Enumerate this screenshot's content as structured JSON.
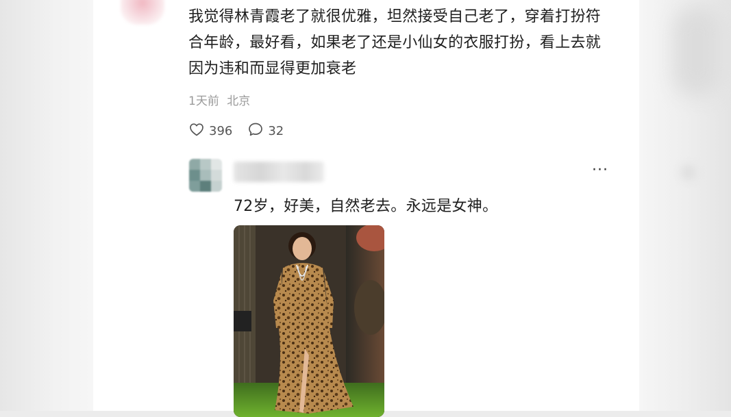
{
  "comment": {
    "text": "我觉得林青霞老了就很优雅，坦然接受自己老了，穿着打扮符合年龄，最好看，如果老了还是小仙女的衣服打扮，看上去就因为违和而显得更加衰老",
    "time": "1天前",
    "location": "北京",
    "likes": "396",
    "replies_count": "32"
  },
  "reply": {
    "more_label": "···",
    "text": "72岁，好美，自然老去。永远是女神。"
  },
  "icons": {
    "like": "heart-outline-icon",
    "comment": "speech-bubble-icon",
    "more": "more-dots-icon"
  },
  "colors": {
    "text": "#1e1e1e",
    "meta": "#9a9a9a",
    "card_bg": "#ffffff",
    "page_bg": "#ececec"
  }
}
